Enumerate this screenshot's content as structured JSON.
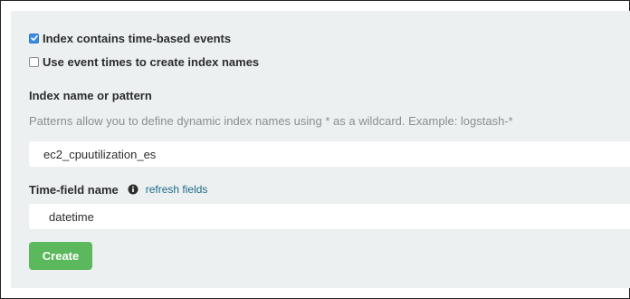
{
  "form": {
    "time_based_checkbox": {
      "label": "Index contains time-based events",
      "checked": true
    },
    "event_times_checkbox": {
      "label": "Use event times to create index names",
      "checked": false
    },
    "index_pattern": {
      "label": "Index name or pattern",
      "help": "Patterns allow you to define dynamic index names using * as a wildcard. Example: logstash-*",
      "value": "ec2_cpuutilization_es"
    },
    "time_field": {
      "label": "Time-field name",
      "info_icon": "info-icon",
      "refresh_link": "refresh fields",
      "value": "datetime"
    },
    "create_button": "Create"
  },
  "colors": {
    "panel_background": "#ecf0f0",
    "checkbox_checked": "#3b8de4",
    "link": "#1f6b8c",
    "create_button": "#5cb85c"
  }
}
